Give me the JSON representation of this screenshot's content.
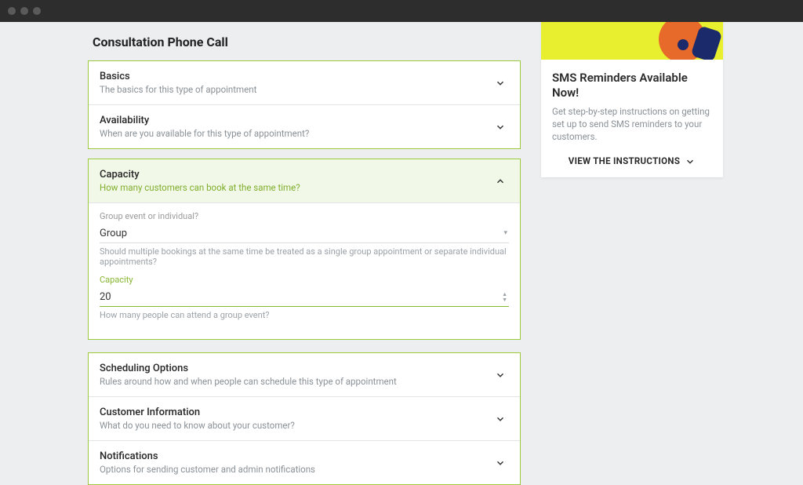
{
  "page": {
    "title": "Consultation Phone Call"
  },
  "sections": {
    "basics": {
      "title": "Basics",
      "subtitle": "The basics for this type of appointment"
    },
    "availability": {
      "title": "Availability",
      "subtitle": "When are you available for this type of appointment?"
    },
    "capacity": {
      "title": "Capacity",
      "subtitle": "How many customers can book at the same time?",
      "fields": {
        "group_label": "Group event or individual?",
        "group_value": "Group",
        "group_help": "Should multiple bookings at the same time be treated as a single group appointment or separate individual appointments?",
        "capacity_label": "Capacity",
        "capacity_value": "20",
        "capacity_help": "How many people can attend a group event?"
      }
    },
    "scheduling": {
      "title": "Scheduling Options",
      "subtitle": "Rules around how and when people can schedule this type of appointment"
    },
    "customer": {
      "title": "Customer Information",
      "subtitle": "What do you need to know about your customer?"
    },
    "notifications": {
      "title": "Notifications",
      "subtitle": "Options for sending customer and admin notifications"
    }
  },
  "promo": {
    "title": "SMS Reminders Available Now!",
    "text": "Get step-by-step instructions on getting set up to send SMS reminders to your customers.",
    "cta": "VIEW THE INSTRUCTIONS"
  }
}
